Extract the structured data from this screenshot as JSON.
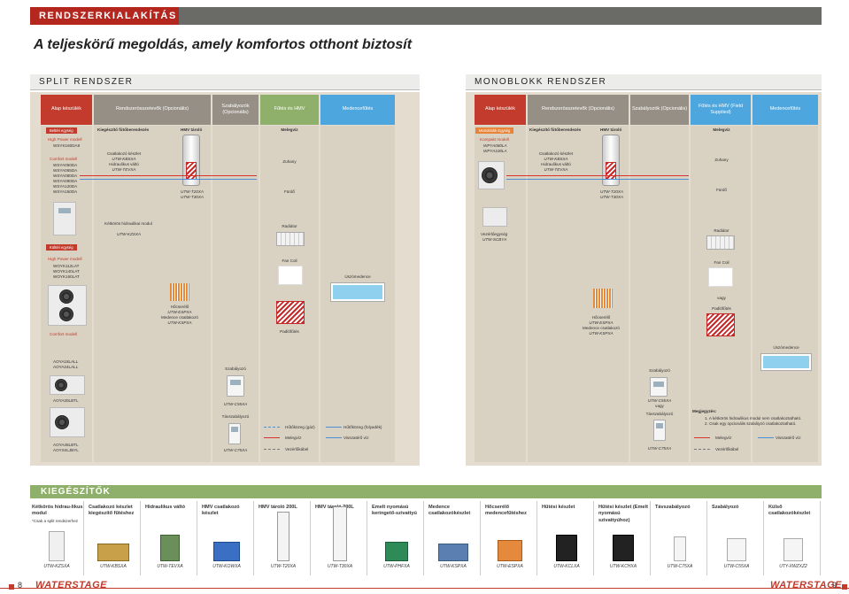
{
  "section_title": "RENDSZERKIALAKÍTÁS",
  "headline": "A teljeskörű megoldás, amely komfortos otthont biztosít",
  "split": {
    "title": "SPLIT RENDSZER",
    "headers": [
      "Alap készülék",
      "Rendszerösszetevők (Opcionális)",
      "Szabályozók (Opcionális)",
      "Fűtés és HMV",
      "Medencefűtés"
    ],
    "indoor_tag": "Beltéri egység",
    "high_power_label": "High Power modell",
    "high_power_model": "WSYK160DA9",
    "comfort_label": "Comfort modell",
    "comfort_models": [
      "WSYA050DA",
      "WSYA065DA",
      "WSYA080DA",
      "WSYA090DA",
      "WSYA120DA",
      "WSYA150DA"
    ],
    "kit_label": "Kiegészítő fűtőberendezés",
    "connect_kit": "Csatlakozó készlet",
    "connect_kit_code": "UTW-KBSXA",
    "hydraulic_valve": "Hidraulikus váltó",
    "hydraulic_valve_code": "UTW-TEVXA",
    "hmv_label": "HMV tároló",
    "hmv_codes": [
      "UTW-T20XA",
      "UTW-T30XA"
    ],
    "warm_water": "Melegvíz",
    "shower": "Zuhany",
    "bath": "Fürdő",
    "two_way_module": "Kétkörös hidraulikai modul",
    "two_way_module_code": "UTW-KZSXA",
    "radiator": "Radiátor",
    "outdoor_tag": "Kültéri egység",
    "outdoor_high_power": "High Power modell",
    "outdoor_high_models": [
      "WOYK112LAT",
      "WOYK140LAT",
      "WOYK160LAT"
    ],
    "fan_coil": "Fan Coil",
    "pool": "Úszómedence",
    "heat_exchanger": "Hőcserélő",
    "heat_exchanger_code": "UTW-ESPXA",
    "pool_kit": "Medence csatlakozó",
    "pool_kit_code": "UTW-KSPXA",
    "floor_heating": "Padlófűtés",
    "outdoor_comfort": "Comfort modell",
    "outdoor_comfort_models_a": [
      "AOYA18LALL",
      "AOYA24LALL"
    ],
    "outdoor_comfort_model_b": "AOYA30LBTL",
    "outdoor_comfort_models_c": [
      "AOYA45LBTL",
      "AOYS4LJBYL"
    ],
    "controller": "Szabályozó",
    "controller_code": "UTW-C55XA",
    "remote": "Távszabályozó",
    "remote_code": "UTW-C75XA",
    "legend": {
      "refrigerant_gas": "Hűtőközeg (gáz)",
      "refrigerant_liquid": "Hűtőközeg (folyadék)",
      "warm_water": "Melegvíz",
      "return_water": "Visszatérő víz",
      "control_cable": "Vezérlőkábel"
    }
  },
  "mono": {
    "title": "MONOBLOKK RENDSZER",
    "headers": [
      "Alap készülék",
      "Rendszerösszetevők (Opcionális)",
      "Szabályozók (Opcionális)",
      "Fűtés és HMV (Field Supplied)",
      "Medencefűtés"
    ],
    "unit_tag": "Monoblokk Egység",
    "compact_label": "Kompakt modell",
    "compact_models": [
      "WPYA080LA",
      "WPYA100LA"
    ],
    "kit_label": "Kiegészítő fűtőberendezés",
    "connect_kit": "Csatlakozó készlet",
    "connect_kit_code": "UTW-KBSXA",
    "hydraulic_valve": "Hidraulikus váltó",
    "hydraulic_valve_code": "UTW-TEVXA",
    "hmv_label": "HMV tároló",
    "hmv_codes": [
      "UTW-T20XA",
      "UTW-T30XA"
    ],
    "warm_water": "Melegvíz",
    "shower": "Zuhany",
    "bath": "Fürdő",
    "control_unit": "Vezérlőegység",
    "control_unit_code": "UTW-SCBYA",
    "radiator": "Radiátor",
    "fan_coil": "Fan Coil",
    "or": "vagy",
    "floor_heating": "Padlófűtés",
    "heat_exchanger": "Hőcserélő",
    "heat_exchanger_code": "UTW-ESPXA",
    "pool_kit": "Medence csatlakozó",
    "pool_kit_code": "UTW-KSPXA",
    "pool": "Úszómedence",
    "controller": "Szabályozó",
    "controller_code": "UTW-C55XA",
    "remote": "Távszabályozó",
    "remote_code": "UTW-C75XA",
    "note_title": "Megjegyzés:",
    "notes": [
      "1. A kétkörös hidraulikus modul nem csatlakoztatható.",
      "2. Csak egy opcionális szabályzó csatlakoztatható."
    ],
    "legend": {
      "warm_water": "Melegvíz",
      "return_water": "Visszatérő víz",
      "control_cable": "Vezérlőkábel"
    }
  },
  "accessories": {
    "title": "KIEGÉSZÍTŐK",
    "items": [
      {
        "name": "Kétkörös hidrau-likus modul",
        "note": "*Csak a split rendszerhez",
        "code": "UTW-KZSXA"
      },
      {
        "name": "Csatlakozó készlet kiegészítő fűtéshez",
        "code": "UTW-KBSXA"
      },
      {
        "name": "Hidraulikus váltó",
        "code": "UTW-TEVXA"
      },
      {
        "name": "HMV csatlakozó készlet",
        "code": "UTW-KOWXA"
      },
      {
        "name": "HMV tároló 200L",
        "code": "UTW-T20XA"
      },
      {
        "name": "HMV tároló 300L",
        "code": "UTW-T30XA"
      },
      {
        "name": "Emelt nyomású keringető-szivattyú",
        "code": "UTW-PHFXA"
      },
      {
        "name": "Medence csatlakozókészlet",
        "code": "UTW-KSPXA"
      },
      {
        "name": "Hőcserélő medencefűtéshez",
        "code": "UTW-ESPXA"
      },
      {
        "name": "Hűtési készlet",
        "code": "UTW-KCLXA"
      },
      {
        "name": "Hűtési készlet (Emelt nyomású szivattyúhoz)",
        "code": "UTW-KCHXA"
      },
      {
        "name": "Távszabályozó",
        "code": "UTW-C75XA"
      },
      {
        "name": "Szabályozó",
        "code": "UTW-C55XA"
      },
      {
        "name": "Külső csatlakozókészlet",
        "code": "UTY-XWZXZ2"
      }
    ]
  },
  "footer": {
    "page_left": "8",
    "page_right": "9",
    "brand": "WATERSTAGE"
  }
}
